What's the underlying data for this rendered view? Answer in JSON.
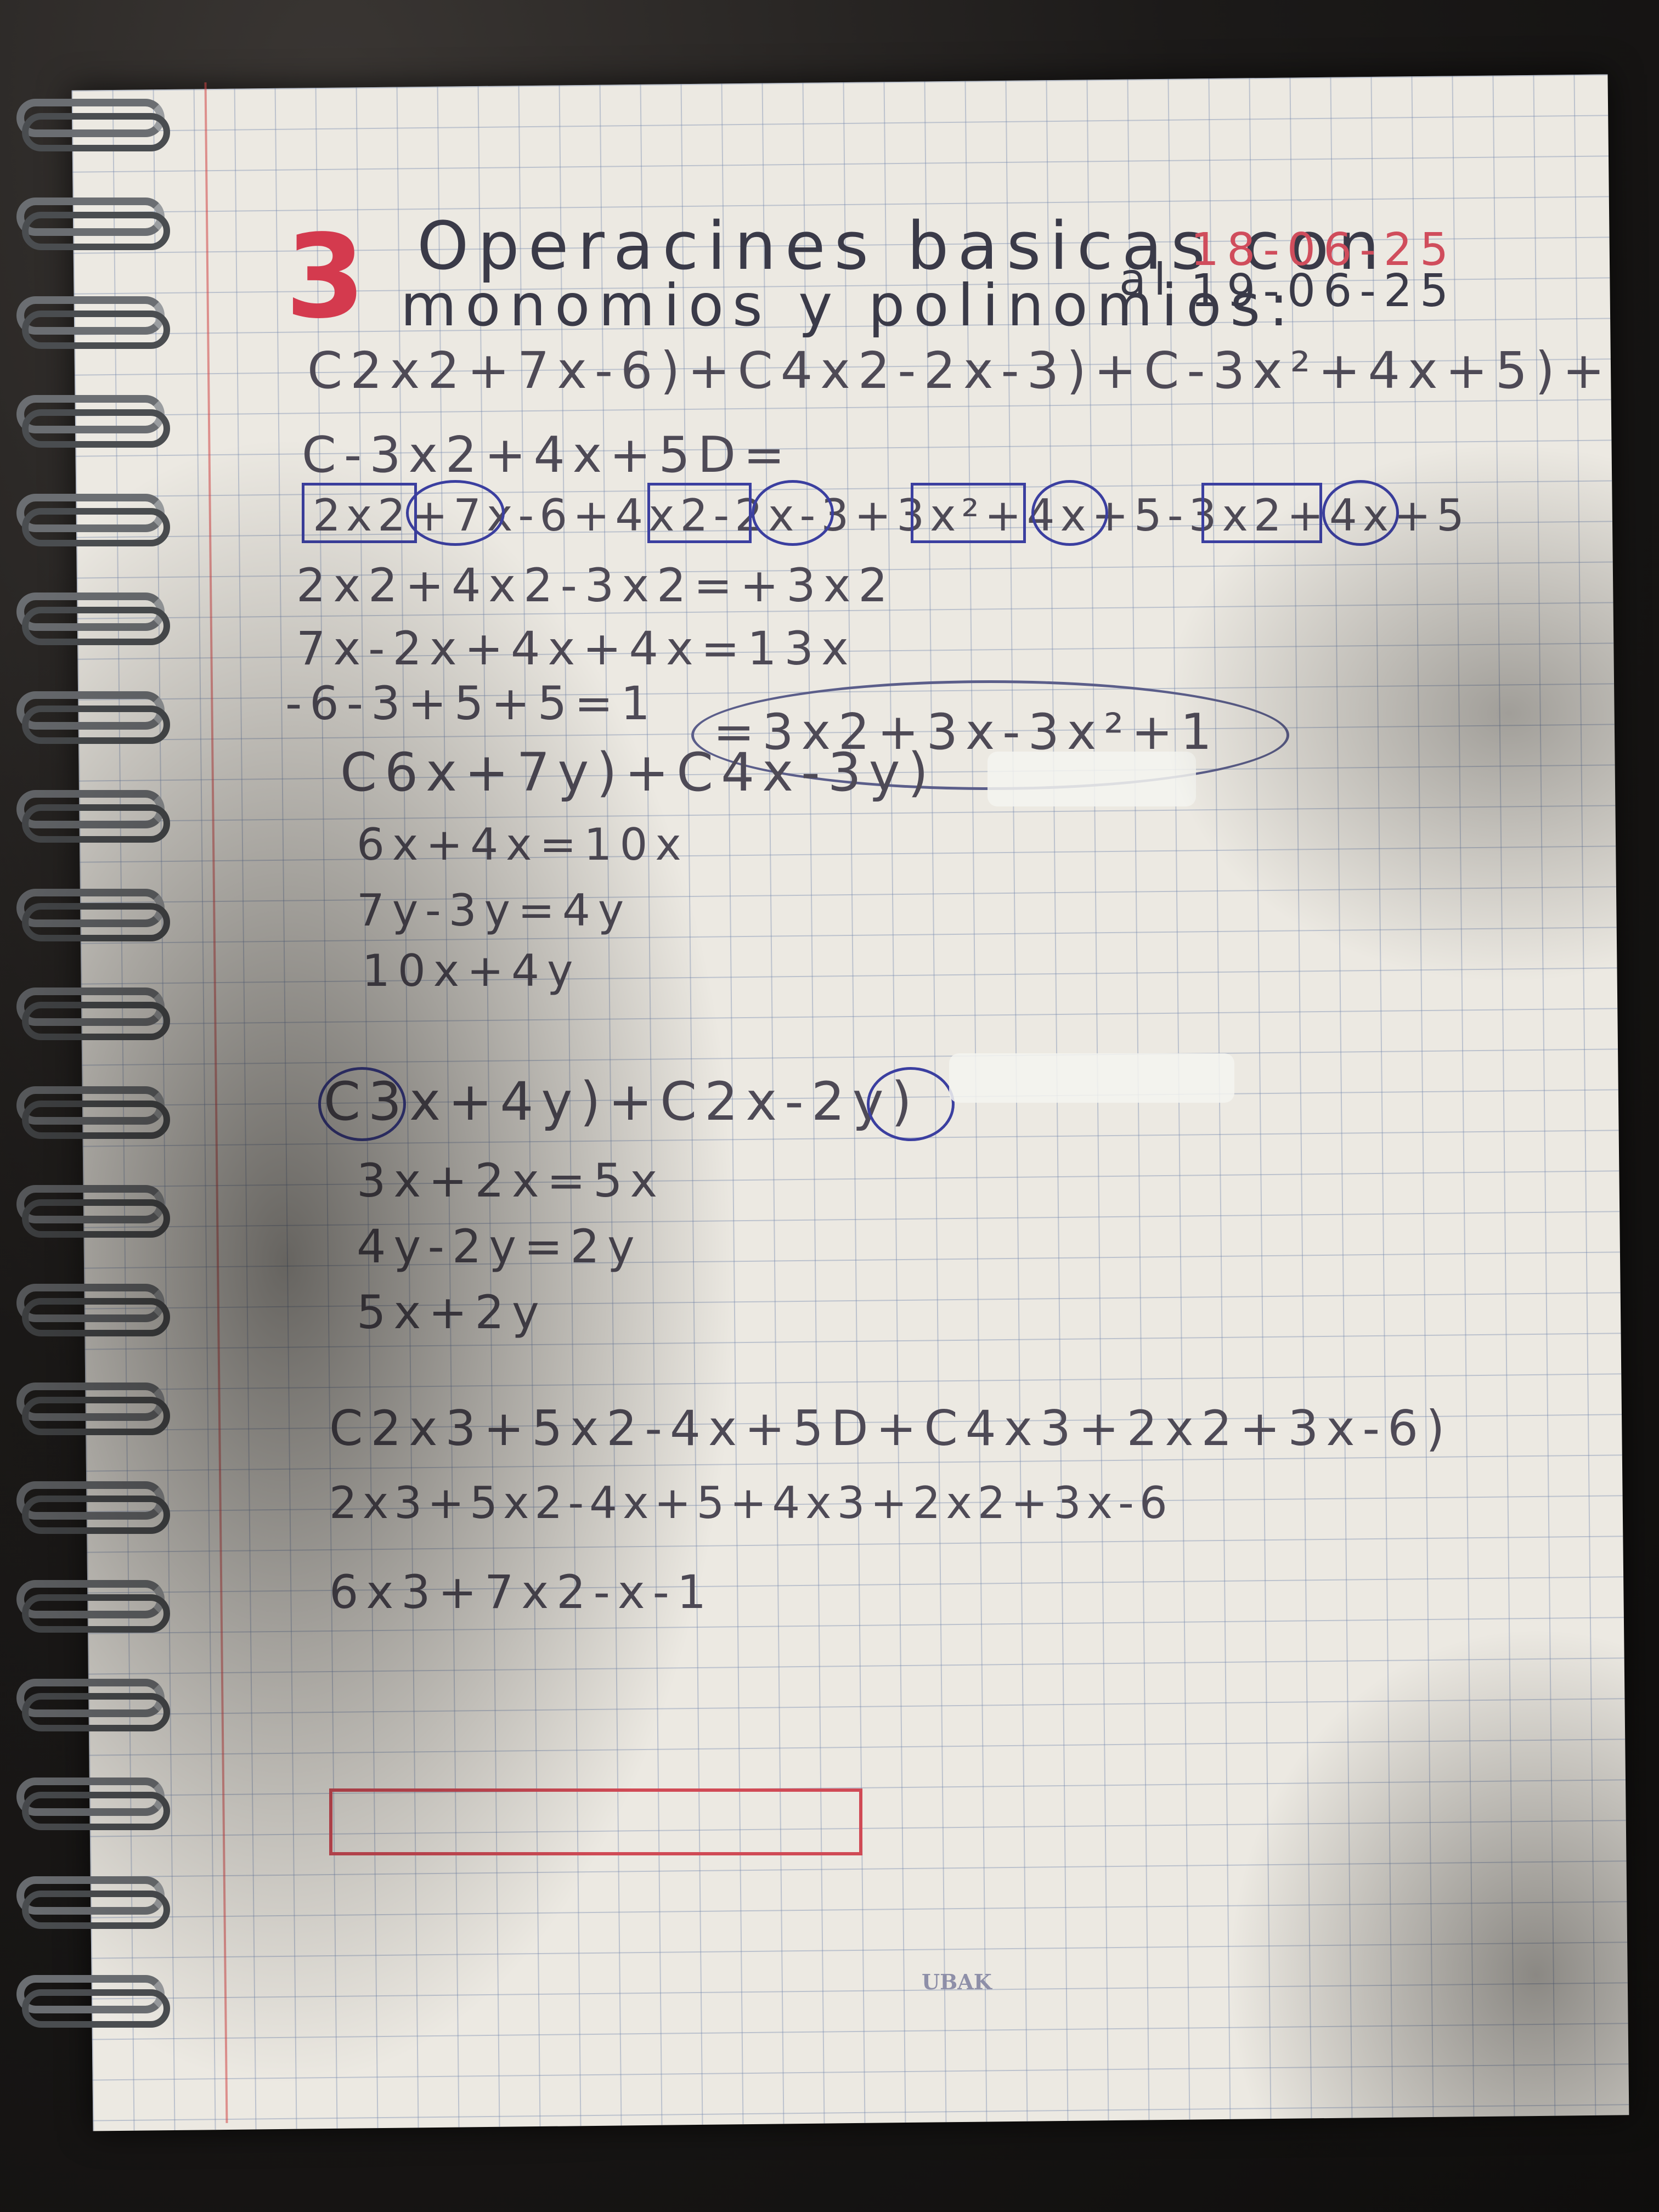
{
  "header": {
    "number": "3",
    "title_line1": "Operacines basicas con",
    "title_line2": "monomios y polinomios:",
    "al": "al",
    "date_from": "18-06-25",
    "date_to": "19-06-25"
  },
  "exercise1": {
    "line1": "C2x2+7x-6)+C4x2-2x-3)+C-3x²+4x+5)+",
    "line2": "C-3x2+4x+5D=",
    "line3": "2x2+7x-6+4x2-2x-3+3x²+4x+5-3x2+4x+5",
    "step1": "2x2+4x2-3x2=+3x2",
    "step2": "7x-2x+4x+4x=13x",
    "step3": "-6-3+5+5=1",
    "result": "=3x2+3x-3x²+1"
  },
  "exercise2": {
    "expr": "C6x+7y)+C4x-3y)",
    "step1": "6x+4x=10x",
    "step2": "7y-3y=4y",
    "result": "10x+4y"
  },
  "exercise3": {
    "expr": "C3x+4y)+C2x-2y)",
    "step1": "3x+2x=5x",
    "step2": "4y-2y=2y",
    "result": "5x+2y"
  },
  "exercise4": {
    "expr": "C2x3+5x2-4x+5D+C4x3+2x2+3x-6)",
    "line2": "2x3+5x2-4x+5+4x3+2x2+3x-6",
    "result": "6x3+7x2-x-1"
  },
  "stamp": "UBAK",
  "colors": {
    "paper": "#ece9e2",
    "grid": "#6e82aa",
    "ink": "#4e4a56",
    "red_ink": "#d04d5c",
    "blue_ink": "#3b3fa0"
  }
}
